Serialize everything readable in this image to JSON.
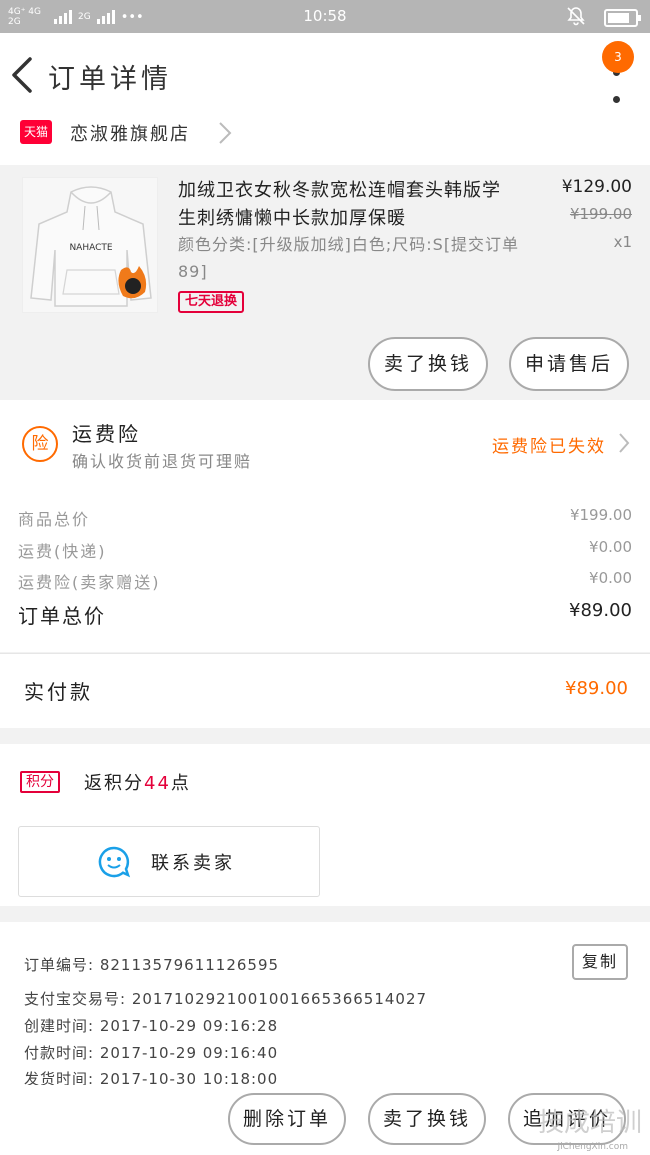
{
  "status_bar": {
    "network": "4G⁺ 4G 2G",
    "network2": "2G",
    "dots": "•••",
    "time": "10:58",
    "battery_level": 0.8
  },
  "header": {
    "title": "订单详情",
    "badge": "3"
  },
  "store": {
    "badge": "天猫",
    "name": "恋淑雅旗舰店"
  },
  "product": {
    "image_text": "NAHACTE",
    "title": "加绒卫衣女秋冬款宽松连帽套头韩版学生刺绣慵懒中长款加厚保暖",
    "spec": "颜色分类:[升级版加绒]白色;尺码:S[提交订单89]",
    "tag": "七天退换",
    "price": "¥129.00",
    "original_price": "¥199.00",
    "quantity": "x1",
    "buttons": [
      "卖了换钱",
      "申请售后"
    ]
  },
  "insurance": {
    "icon": "险",
    "title": "运费险",
    "subtitle": "确认收货前退货可理赔",
    "status": "运费险已失效"
  },
  "summary": {
    "rows": [
      {
        "label": "商品总价",
        "value": "¥199.00"
      },
      {
        "label": "运费(快递)",
        "value": "¥0.00"
      },
      {
        "label": "运费险(卖家赠送)",
        "value": "¥0.00"
      }
    ],
    "total_label": "订单总价",
    "total_value": "¥89.00"
  },
  "paid": {
    "label": "实付款",
    "value": "¥89.00"
  },
  "points": {
    "badge": "积分",
    "prefix": "返积分",
    "count": "44",
    "suffix": "点",
    "contact_label": "联系卖家"
  },
  "order_info": {
    "order_no": "订单编号: 82113579611126595",
    "copy_label": "复制",
    "alipay_no": "支付宝交易号: 2017102921001001665366514027",
    "created": "创建时间: 2017-10-29 09:16:28",
    "paid_time": "付款时间: 2017-10-29 09:16:40",
    "shipped": "发货时间: 2017-10-30 10:18:00"
  },
  "bottom_bar": {
    "buttons": [
      "删除订单",
      "卖了换钱",
      "追加评价"
    ]
  },
  "watermark": {
    "text": "技成培训",
    "sub": "JiChengXin.com"
  }
}
